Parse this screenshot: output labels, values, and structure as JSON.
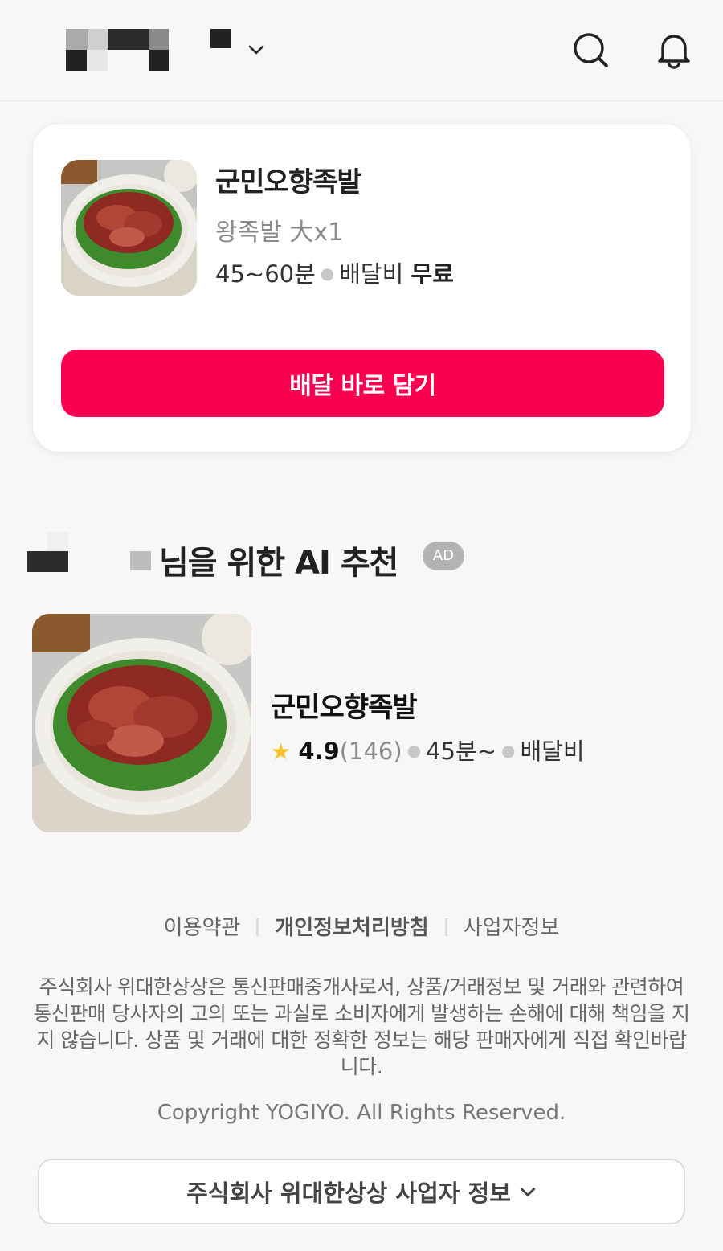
{
  "colors": {
    "accent": "#fa0050",
    "star": "#f7c325",
    "background": "#f7f7f7"
  },
  "header": {
    "icons": [
      "chevron-down-icon",
      "search-icon",
      "bell-icon"
    ]
  },
  "order_card": {
    "store_name": "군민오향족발",
    "menu": "왕족발 大x1",
    "time": "45~60분",
    "fee_label": "배달비",
    "fee_value": "무료",
    "cta_label": "배달 바로 담기"
  },
  "recommend": {
    "title": "님을 위한 AI 추천",
    "badge": "AD",
    "store_name": "군민오향족발",
    "rating": "4.9",
    "review_count": "(146)",
    "time": "45분~",
    "fee_label": "배달비"
  },
  "footer": {
    "links": [
      "이용약관",
      "개인정보처리방침",
      "사업자정보"
    ],
    "disclaimer": "주식회사 위대한상상은 통신판매중개사로서, 상품/거래정보 및 거래와 관련하여 통신판매 당사자의 고의 또는 과실로 소비자에게 발생하는 손해에 대해 책임을 지지 않습니다. 상품 및 거래에 대한 정확한 정보는 해당 판매자에게 직접 확인바랍니다.",
    "copyright": "Copyright YOGIYO. All Rights Reserved.",
    "biz_button": "주식회사 위대한상상 사업자 정보"
  }
}
